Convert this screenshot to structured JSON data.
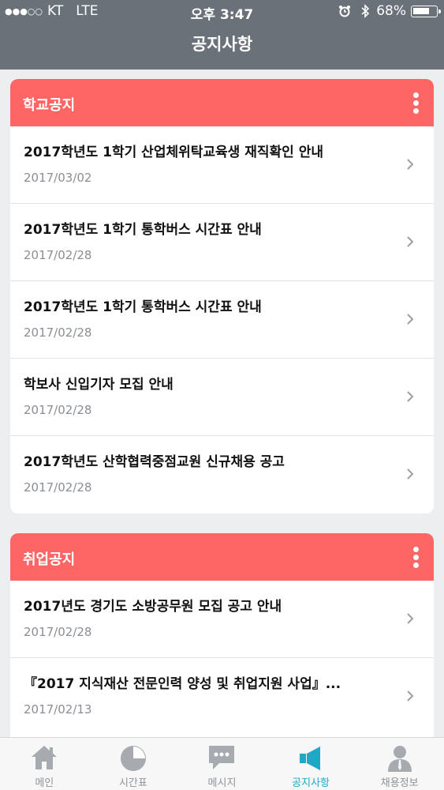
{
  "status_bar": {
    "signal": "●●●○○",
    "carrier": "KT",
    "network": "LTE",
    "time": "오후 3:47",
    "battery": "68%"
  },
  "header": {
    "title": "공지사항"
  },
  "sections": [
    {
      "title": "학교공지",
      "items": [
        {
          "title": "2017학년도 1학기 산업체위탁교육생 재직확인 안내",
          "date": "2017/03/02"
        },
        {
          "title": "2017학년도 1학기 통학버스 시간표 안내",
          "date": "2017/02/28"
        },
        {
          "title": "2017학년도 1학기 통학버스 시간표 안내",
          "date": "2017/02/28"
        },
        {
          "title": "학보사 신입기자 모집 안내",
          "date": "2017/02/28"
        },
        {
          "title": "2017학년도 산학협력중점교원 신규채용 공고",
          "date": "2017/02/28"
        }
      ]
    },
    {
      "title": "취업공지",
      "items": [
        {
          "title": "2017년도 경기도 소방공무원 모집 공고 안내",
          "date": "2017/02/28"
        },
        {
          "title": "『2017 지식재산 전문인력 양성 및 취업지원 사업』...",
          "date": "2017/02/13"
        }
      ]
    }
  ],
  "tabs": [
    {
      "label": "메인",
      "icon": "home-icon"
    },
    {
      "label": "시간표",
      "icon": "clock-icon"
    },
    {
      "label": "메시지",
      "icon": "message-icon"
    },
    {
      "label": "공지사항",
      "icon": "megaphone-icon",
      "active": true
    },
    {
      "label": "채용정보",
      "icon": "person-icon"
    }
  ],
  "colors": {
    "header_bg": "#6a7179",
    "section_header": "#fe6665",
    "active_tab": "#1fa8c7"
  }
}
